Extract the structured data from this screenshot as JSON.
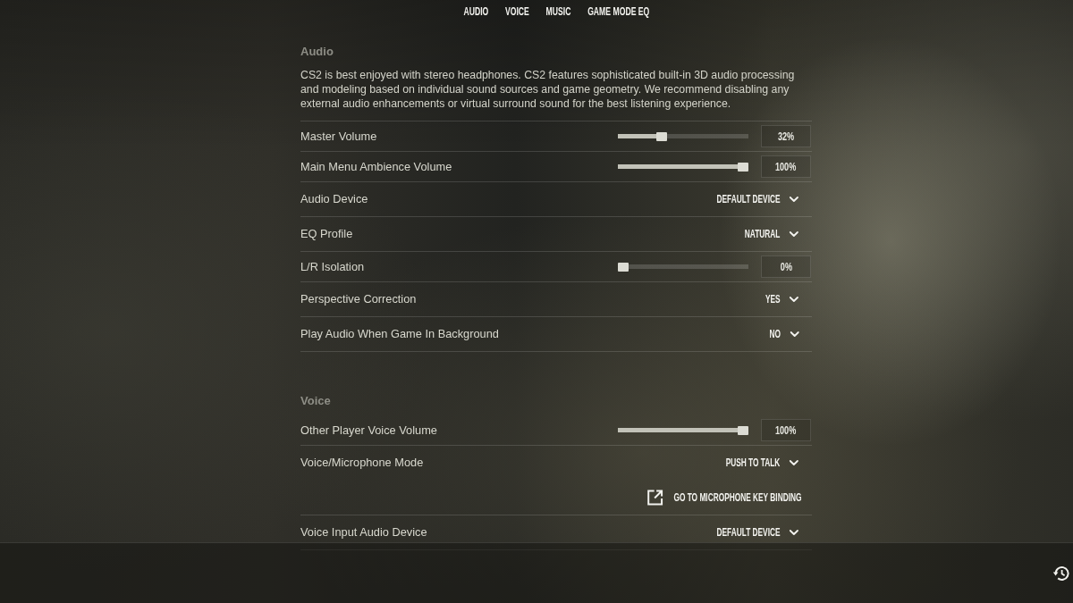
{
  "tabs": [
    {
      "label": "AUDIO"
    },
    {
      "label": "VOICE"
    },
    {
      "label": "MUSIC"
    },
    {
      "label": "GAME MODE EQ"
    }
  ],
  "sections": [
    {
      "title": "Audio",
      "description": "CS2 is best enjoyed with stereo headphones. CS2 features sophisticated built-in 3D audio processing and modeling based on individual sound sources and game geometry. We recommend disabling any external audio enhancements or virtual surround sound for the best listening experience.",
      "settings": [
        {
          "kind": "slider",
          "label": "Master Volume",
          "level": 0.32,
          "reading": "32%"
        },
        {
          "kind": "slider",
          "label": "Main Menu Ambience Volume",
          "level": 1,
          "reading": "100%"
        },
        {
          "kind": "dropdown",
          "label": "Audio Device",
          "value": "DEFAULT DEVICE"
        },
        {
          "kind": "dropdown",
          "label": "EQ Profile",
          "value": "NATURAL"
        },
        {
          "kind": "slider",
          "label": "L/R Isolation",
          "level": 0,
          "reading": "0%"
        },
        {
          "kind": "dropdown",
          "label": "Perspective Correction",
          "value": "YES"
        },
        {
          "kind": "dropdown",
          "label": "Play Audio When Game In Background",
          "value": "NO"
        }
      ]
    },
    {
      "title": "Voice",
      "settings": [
        {
          "kind": "slider",
          "label": "Other Player Voice Volume",
          "level": 1,
          "reading": "100%"
        },
        {
          "kind": "dropdown",
          "label": "Voice/Microphone Mode",
          "value": "PUSH TO TALK"
        },
        {
          "kind": "link",
          "label": "GO TO MICROPHONE KEY BINDING"
        },
        {
          "kind": "dropdown",
          "label": "Voice Input Audio Device",
          "value": "DEFAULT DEVICE"
        }
      ]
    }
  ]
}
